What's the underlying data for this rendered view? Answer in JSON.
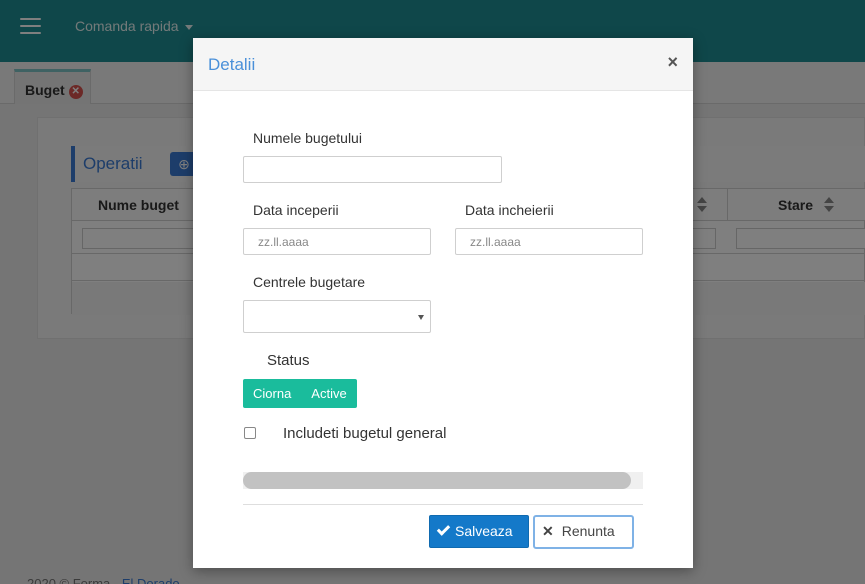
{
  "topbar": {
    "quick_menu_label": "Comanda rapida"
  },
  "tabs": [
    {
      "label": "Buget"
    }
  ],
  "operations": {
    "title": "Operatii"
  },
  "grid": {
    "columns": [
      "Nume buget",
      "Stare"
    ]
  },
  "footer": {
    "text": "2020 © Forma - ",
    "link": "El Dorado"
  },
  "modal": {
    "title": "Detalii",
    "close_symbol": "×",
    "fields": {
      "budget_name_label": "Numele bugetului",
      "budget_name_value": "",
      "start_date_label": "Data inceperii",
      "start_date_placeholder": "zz.ll.aaaa",
      "end_date_label": "Data incheierii",
      "end_date_placeholder": "zz.ll.aaaa",
      "budget_centers_label": "Centrele bugetare",
      "status_label": "Status",
      "status_options": [
        "Ciorna",
        "Active"
      ],
      "include_general_label": "Includeti bugetul general"
    },
    "buttons": {
      "save": "Salveaza",
      "cancel": "Renunta"
    }
  },
  "colors": {
    "topbar": "#1f8f94",
    "accent": "#4a90d9",
    "status": "#1abc9c",
    "save": "#1479c9"
  }
}
